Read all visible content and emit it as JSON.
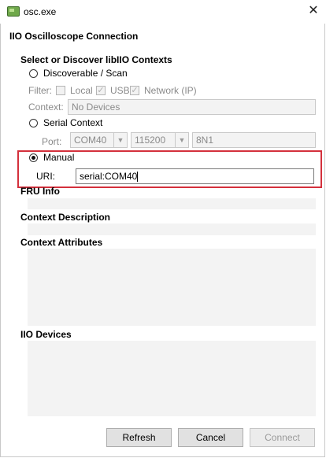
{
  "window": {
    "title": "osc.exe",
    "close_symbol": "✕"
  },
  "heading": "IIO Oscilloscope Connection",
  "discover_section": {
    "title": "Select or Discover libIIO Contexts",
    "discoverable_label": "Discoverable / Scan",
    "filter_label": "Filter:",
    "filters": [
      {
        "label": "Local",
        "checked": false
      },
      {
        "label": "USB",
        "checked": true
      },
      {
        "label": "Network (IP)",
        "checked": true
      }
    ],
    "context_label": "Context:",
    "context_value": "No Devices"
  },
  "serial_section": {
    "label": "Serial Context",
    "port_label": "Port:",
    "port_value": "COM40",
    "baud_value": "115200",
    "format_value": "8N1"
  },
  "manual_section": {
    "label": "Manual",
    "uri_label": "URI:",
    "uri_value": "serial:COM40",
    "selected": true
  },
  "info_sections": {
    "fru": "FRU Info",
    "context_description": "Context Description",
    "context_attributes": "Context Attributes",
    "iio_devices": "IIO Devices"
  },
  "buttons": {
    "refresh": "Refresh",
    "cancel": "Cancel",
    "connect": "Connect"
  },
  "colors": {
    "highlight_border": "#d4303c",
    "panel_background": "#f3f3f3"
  }
}
